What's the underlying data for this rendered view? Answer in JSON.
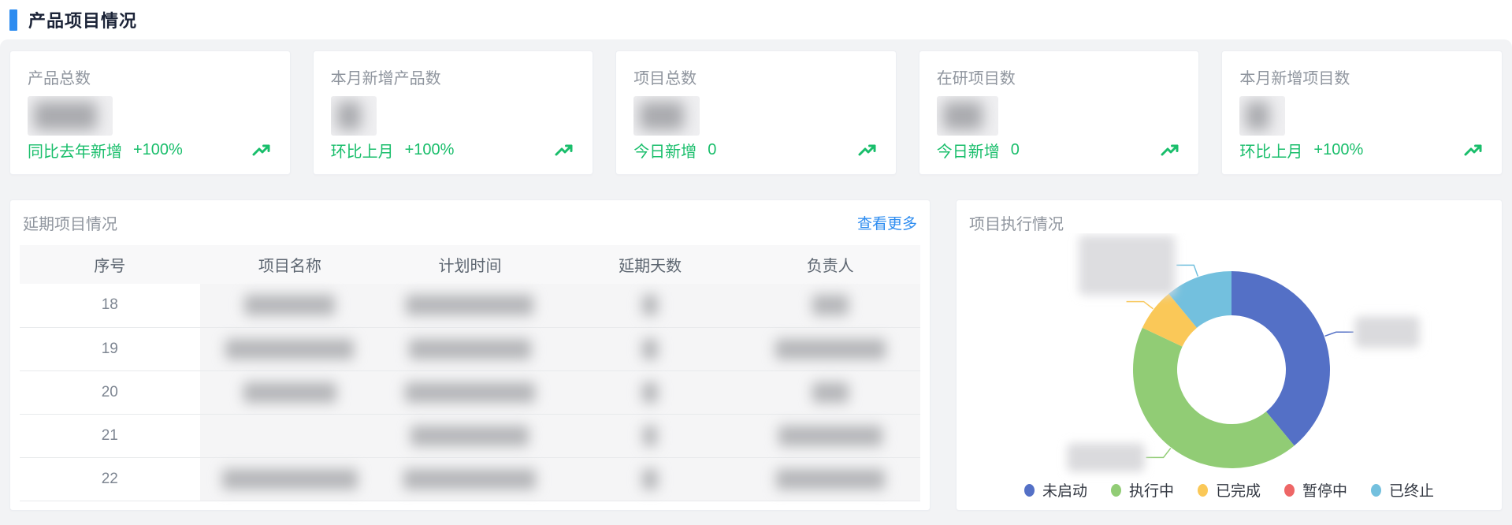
{
  "page": {
    "title": "产品项目情况"
  },
  "theme": {
    "accent_blue": "#2d8cf0",
    "success_green": "#19be6b",
    "content_bg": "#f2f3f5"
  },
  "stat_cards": [
    {
      "title": "产品总数",
      "value_blurred": true,
      "blur_width": 80,
      "metric_label": "同比去年新增",
      "metric_value": "+100%",
      "trend_icon": "trend-up-icon"
    },
    {
      "title": "本月新增产品数",
      "value_blurred": true,
      "blur_width": 30,
      "metric_label": "环比上月",
      "metric_value": "+100%",
      "trend_icon": "trend-up-icon"
    },
    {
      "title": "项目总数",
      "value_blurred": true,
      "blur_width": 56,
      "metric_label": "今日新增",
      "metric_value": "0",
      "trend_icon": "trend-up-icon"
    },
    {
      "title": "在研项目数",
      "value_blurred": true,
      "blur_width": 50,
      "metric_label": "今日新增",
      "metric_value": "0",
      "trend_icon": "trend-up-icon"
    },
    {
      "title": "本月新增项目数",
      "value_blurred": true,
      "blur_width": 30,
      "metric_label": "环比上月",
      "metric_value": "+100%",
      "trend_icon": "trend-up-icon"
    }
  ],
  "delayed_panel": {
    "title": "延期项目情况",
    "more_link": "查看更多",
    "table": {
      "columns": [
        "序号",
        "项目名称",
        "计划时间",
        "延期天数",
        "负责人"
      ],
      "cells_blurred": true,
      "rows": [
        {
          "seq": "18",
          "blur_widths": [
            115,
            162,
            20,
            46
          ]
        },
        {
          "seq": "19",
          "blur_widths": [
            163,
            155,
            20,
            140
          ]
        },
        {
          "seq": "20",
          "blur_widths": [
            118,
            165,
            20,
            46
          ]
        },
        {
          "seq": "21",
          "blur_widths": [
            0,
            150,
            18,
            132
          ]
        },
        {
          "seq": "22",
          "blur_widths": [
            172,
            168,
            20,
            138
          ]
        }
      ]
    }
  },
  "execution_panel": {
    "title": "项目执行情况",
    "chart_data": {
      "type": "pie",
      "variant": "donut",
      "legend_position": "bottom",
      "data_labels_blurred": true,
      "series": [
        {
          "name": "未启动",
          "color": "#5470c6",
          "value_pct_estimated": 39
        },
        {
          "name": "执行中",
          "color": "#91cc75",
          "value_pct_estimated": 43
        },
        {
          "name": "已完成",
          "color": "#fac858",
          "value_pct_estimated": 7
        },
        {
          "name": "暂停中",
          "color": "#ee6666",
          "value_pct_estimated": 0
        },
        {
          "name": "已终止",
          "color": "#73c0de",
          "value_pct_estimated": 11
        }
      ]
    }
  }
}
